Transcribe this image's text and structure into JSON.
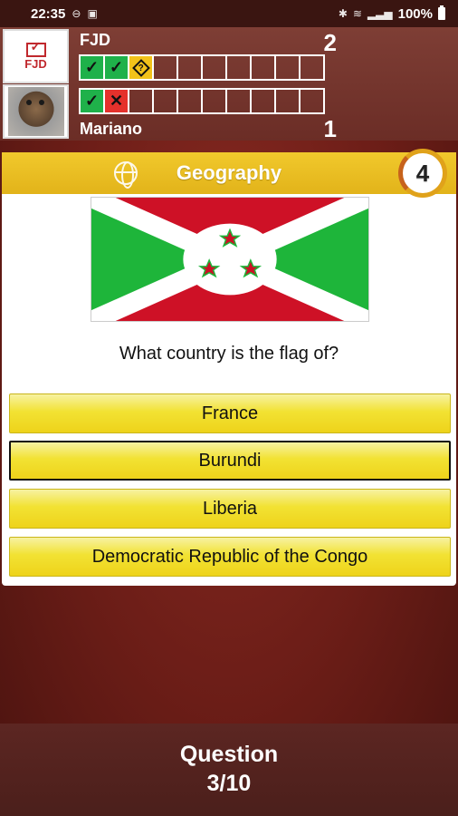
{
  "status": {
    "time": "22:35",
    "battery": "100%"
  },
  "players": [
    {
      "name": "FJD",
      "score": "2",
      "avatar": "fjd-logo",
      "results": [
        "correct",
        "correct",
        "current",
        "empty",
        "empty",
        "empty",
        "empty",
        "empty",
        "empty",
        "empty"
      ]
    },
    {
      "name": "Mariano",
      "score": "1",
      "avatar": "groot-avatar",
      "results": [
        "correct",
        "wrong",
        "empty",
        "empty",
        "empty",
        "empty",
        "empty",
        "empty",
        "empty",
        "empty"
      ]
    }
  ],
  "category": {
    "label": "Geography",
    "icon": "globe-icon",
    "timer": "4"
  },
  "question": {
    "text": "What country is the flag of?",
    "flag": "burundi-flag"
  },
  "answers": [
    {
      "label": "France",
      "selected": false
    },
    {
      "label": "Burundi",
      "selected": true
    },
    {
      "label": "Liberia",
      "selected": false
    },
    {
      "label": "Democratic Republic of the Congo",
      "selected": false
    }
  ],
  "footer": {
    "label": "Question",
    "progress": "3/10"
  },
  "colors": {
    "correct": "#1fb14a",
    "wrong": "#e5312c",
    "current": "#f2c21a",
    "category_bar": "#e8bb22",
    "answer": "#f2e233"
  }
}
